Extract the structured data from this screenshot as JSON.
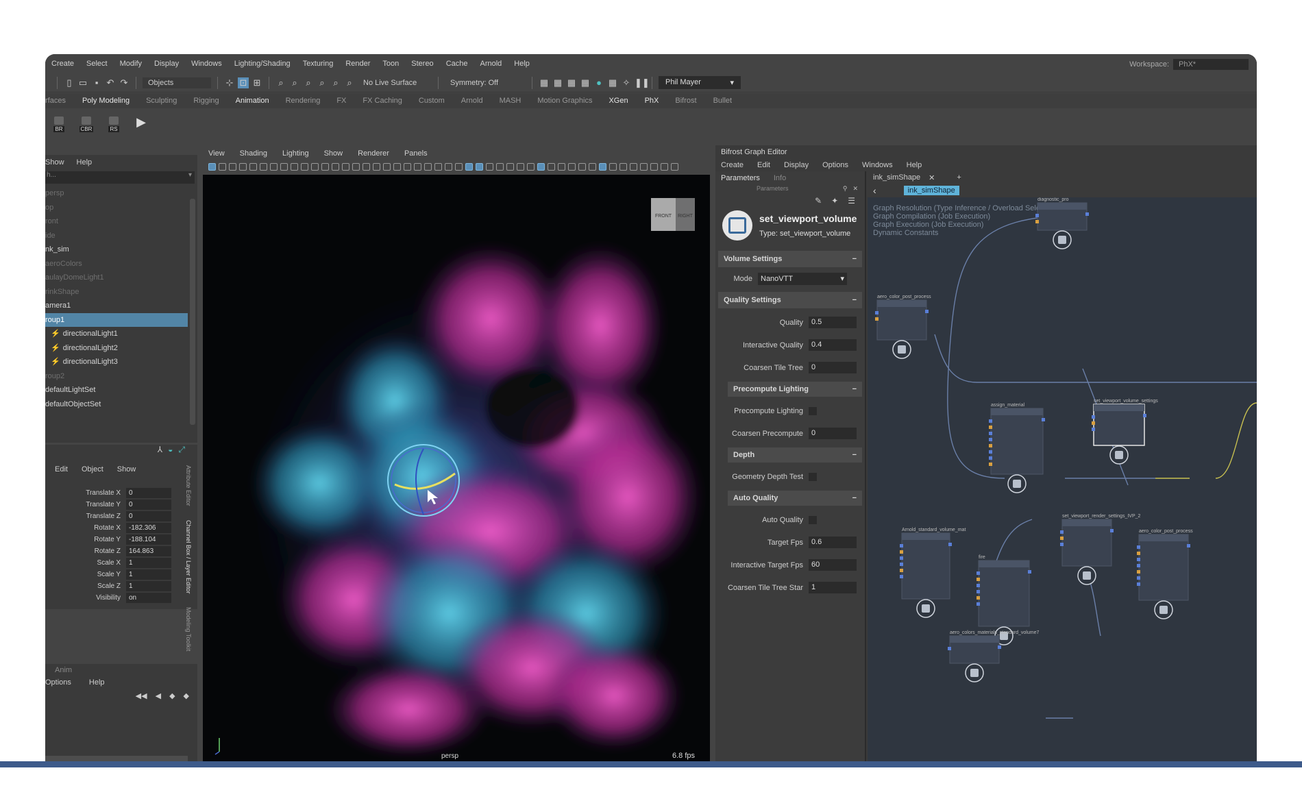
{
  "menubar": {
    "items": [
      "Create",
      "Select",
      "Modify",
      "Display",
      "Windows",
      "Lighting/Shading",
      "Texturing",
      "Render",
      "Toon",
      "Stereo",
      "Cache",
      "Arnold",
      "Help"
    ],
    "workspace_label": "Workspace:",
    "workspace_value": "PhX*"
  },
  "toolbar": {
    "objects_label": "Objects",
    "live_surface": "No Live Surface",
    "symmetry": "Symmetry: Off",
    "user": "Phil Mayer"
  },
  "shelf_tabs": [
    "rfaces",
    "Poly Modeling",
    "Sculpting",
    "Rigging",
    "Animation",
    "Rendering",
    "FX",
    "FX Caching",
    "Custom",
    "Arnold",
    "MASH",
    "Motion Graphics",
    "XGen",
    "PhX",
    "Bifrost",
    "Bullet"
  ],
  "shelf_active": [
    "Poly Modeling",
    "Animation",
    "XGen",
    "PhX"
  ],
  "shelf_buttons": [
    "BR",
    "CBR",
    "RS"
  ],
  "outliner": {
    "menu": [
      "Show",
      "Help"
    ],
    "search_placeholder": "h...",
    "rows": [
      {
        "label": "persp",
        "style": "dim"
      },
      {
        "label": "op",
        "style": "dim"
      },
      {
        "label": "ront",
        "style": "dim"
      },
      {
        "label": "ide",
        "style": "dim"
      },
      {
        "label": "nk_sim",
        "style": "normal"
      },
      {
        "label": "aeroColors",
        "style": "dim"
      },
      {
        "label": "aulayDomeLight1",
        "style": "dim"
      },
      {
        "label": "rinkShape",
        "style": "dim"
      },
      {
        "label": "amera1",
        "style": "normal"
      },
      {
        "label": "roup1",
        "style": "selected"
      },
      {
        "label": "directionalLight1",
        "style": "child"
      },
      {
        "label": "directionalLight2",
        "style": "child"
      },
      {
        "label": "directionalLight3",
        "style": "child"
      },
      {
        "label": "roup2",
        "style": "dim"
      },
      {
        "label": "defaultLightSet",
        "style": "normal"
      },
      {
        "label": "defaultObjectSet",
        "style": "normal"
      }
    ]
  },
  "channel_box": {
    "menu": [
      "Edit",
      "Object",
      "Show"
    ],
    "rows": [
      {
        "k": "Translate X",
        "v": "0"
      },
      {
        "k": "Translate Y",
        "v": "0"
      },
      {
        "k": "Translate Z",
        "v": "0"
      },
      {
        "k": "Rotate X",
        "v": "-182.306"
      },
      {
        "k": "Rotate Y",
        "v": "-188.104"
      },
      {
        "k": "Rotate Z",
        "v": "164.863"
      },
      {
        "k": "Scale X",
        "v": "1"
      },
      {
        "k": "Scale Y",
        "v": "1"
      },
      {
        "k": "Scale Z",
        "v": "1"
      },
      {
        "k": "Visibility",
        "v": "on"
      }
    ],
    "vtabs": [
      "Attribute Editor",
      "Channel Box / Layer Editor",
      "Modeling Toolkit"
    ]
  },
  "layer_editor": {
    "title": "Anim",
    "menu": [
      "Options",
      "Help"
    ]
  },
  "viewport": {
    "menu": [
      "View",
      "Shading",
      "Lighting",
      "Show",
      "Renderer",
      "Panels"
    ],
    "camera_label": "persp",
    "fps": "6.8 fps",
    "cube_front": "FRONT",
    "cube_right": "RIGHT",
    "colors": {
      "magenta": "#d03aa8",
      "cyan": "#2fa8c6",
      "deep": "#3a3f8f",
      "bg": "#050608"
    }
  },
  "bifrost": {
    "title": "Bifrost Graph Editor",
    "menu": [
      "Create",
      "Edit",
      "Display",
      "Options",
      "Windows",
      "Help"
    ],
    "param_tabs": [
      "Parameters",
      "Info"
    ],
    "param_subtitle": "Parameters",
    "node_title": "set_viewport_volume",
    "node_type": "Type: set_viewport_volume",
    "sections": {
      "volume": "Volume Settings",
      "quality": "Quality Settings",
      "precompute": "Precompute Lighting",
      "depth": "Depth",
      "auto": "Auto Quality"
    },
    "mode_label": "Mode",
    "mode_value": "NanoVTT",
    "quality_rows": [
      {
        "k": "Quality",
        "v": "0.5"
      },
      {
        "k": "Interactive Quality",
        "v": "0.4"
      },
      {
        "k": "Coarsen Tile Tree",
        "v": "0"
      }
    ],
    "precompute_rows": [
      {
        "k": "Precompute Lighting",
        "type": "check"
      },
      {
        "k": "Coarsen Precompute",
        "v": "0"
      }
    ],
    "depth_rows": [
      {
        "k": "Geometry Depth Test",
        "type": "check"
      }
    ],
    "auto_rows": [
      {
        "k": "Auto Quality",
        "type": "check"
      },
      {
        "k": "Target Fps",
        "v": "0.6"
      },
      {
        "k": "Interactive Target Fps",
        "v": "60"
      },
      {
        "k": "Coarsen Tile Tree Star",
        "v": "1"
      }
    ],
    "graph_tab": "ink_simShape",
    "graph_crumb": "ink_simShape",
    "graph_info": [
      "Graph Resolution (Type Inference / Overload Selection)",
      "Graph Compilation (Job Execution)",
      "Graph Execution (Job Execution)",
      "Dynamic Constants"
    ],
    "nodes": {
      "diagnostic": "diagnostic_pro",
      "color_post": "aero_color_post_process",
      "assign_material": "assign_material",
      "set_viewport": "set_viewport_volume_settings",
      "render_settings": "set_viewport_render_settings_IVP_2",
      "arnold_mat": "Arnold_standard_volume_mat",
      "fire": "fire",
      "color_post2": "aero_color_post_process",
      "colors_material": "aero_colors_materials_standard_volume7"
    }
  }
}
